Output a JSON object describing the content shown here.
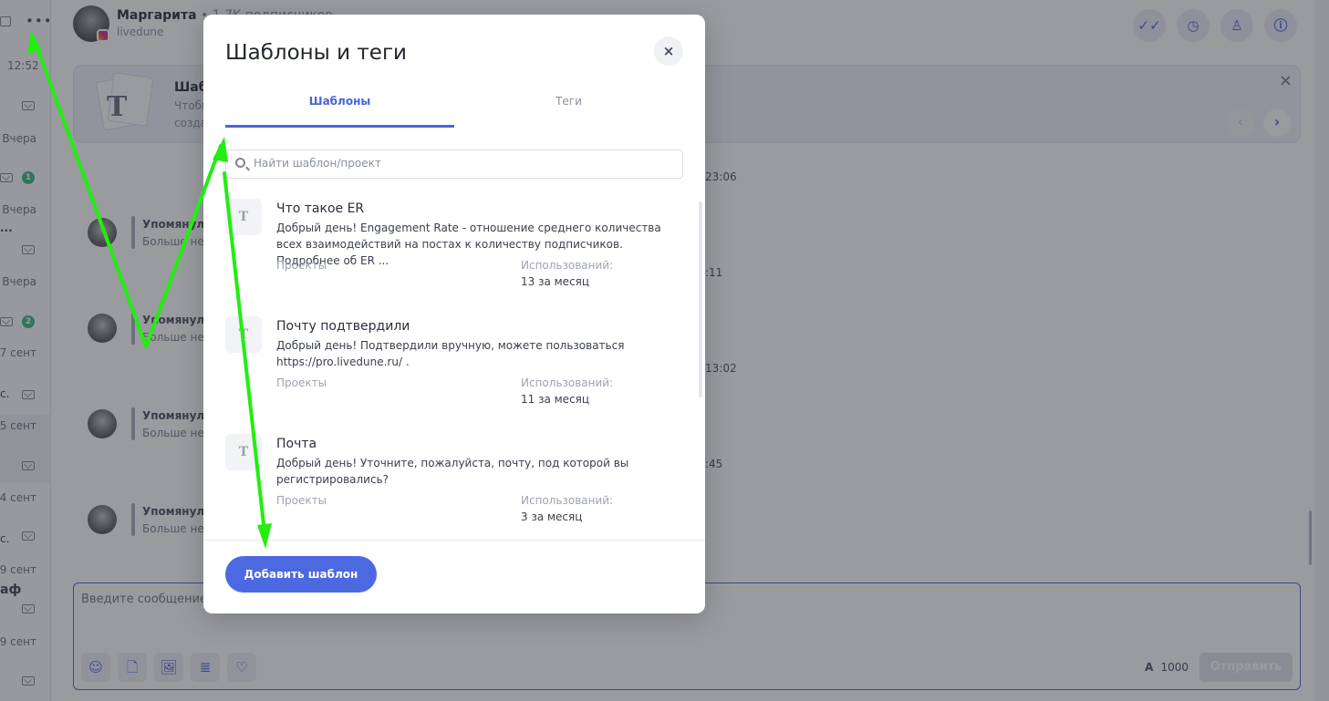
{
  "left_panel": {
    "time": "12:52",
    "rows": [
      {
        "date": "Вчера",
        "badge": "1",
        "snippet": ""
      },
      {
        "date": "Вчера",
        "badge": "",
        "snippet": "..."
      },
      {
        "date": "Вчера",
        "badge": "2",
        "snippet": ""
      },
      {
        "date": "7 сент",
        "badge": "",
        "snippet": "с."
      },
      {
        "date": "5 сент",
        "badge": "",
        "snippet": ""
      },
      {
        "date": "4 сент",
        "badge": "",
        "snippet": "с."
      },
      {
        "date": "9 сент",
        "badge": "",
        "snippet": "аф"
      },
      {
        "date": "9 сент",
        "badge": "",
        "snippet": ""
      }
    ]
  },
  "header": {
    "name": "Маргарита",
    "followers": " • 1.7K подписчиков",
    "subtitle": "livedune",
    "buttons": [
      "✓✓",
      "◷",
      "♙",
      "ⓘ"
    ]
  },
  "tip": {
    "title": "Шабл",
    "line1": "Чтобы",
    "line2": "созда",
    "close": "×",
    "prev": "‹",
    "next": "›"
  },
  "messages": [
    {
      "title": "Упомянул(-",
      "text": "Больше нед",
      "time": "23:06"
    },
    {
      "title": "Упомянул(-",
      "text": "Больше нед",
      "time": ":11"
    },
    {
      "title": "Упомянул(-",
      "text": "Больше нед",
      "time": "13:02"
    },
    {
      "title": "Упомянул(-",
      "text": "Больше нед",
      "time": ":45"
    }
  ],
  "composer": {
    "placeholder": "Введите сообщение и",
    "tools": [
      "☺",
      "🗋",
      "🖼",
      "≣",
      "♡"
    ],
    "counter_a": "A",
    "counter_value": "1000",
    "send_label": "Отправить"
  },
  "modal": {
    "title": "Шаблоны и теги",
    "close": "×",
    "tabs": {
      "active": "Шаблоны",
      "inactive": "Теги"
    },
    "search_placeholder": "Найти шаблон/проект",
    "items": [
      {
        "icon": "T",
        "title": "Что такое ER",
        "text": "Добрый день! Engagement Rate - отношение среднего количества всех взаимодействий на постах к количеству подписчиков. Подробнее об ER ...",
        "projects_label": "Проекты",
        "used_label": "Использований:",
        "used_value": "13 за месяц"
      },
      {
        "icon": "T",
        "title": "Почту подтвердили",
        "text": "Добрый день! Подтвердили вручную, можете пользоваться https://pro.livedune.ru/ .",
        "projects_label": "Проекты",
        "used_label": "Использований:",
        "used_value": "11 за месяц"
      },
      {
        "icon": "T",
        "title": "Почта",
        "text": "Добрый день! Уточните, пожалуйста, почту, под которой вы регистрировались?",
        "projects_label": "Проекты",
        "used_label": "Использований:",
        "used_value": "3 за месяц"
      }
    ],
    "add_button": "Добавить шаблон"
  },
  "annotation": {
    "color": "#22ee11"
  }
}
